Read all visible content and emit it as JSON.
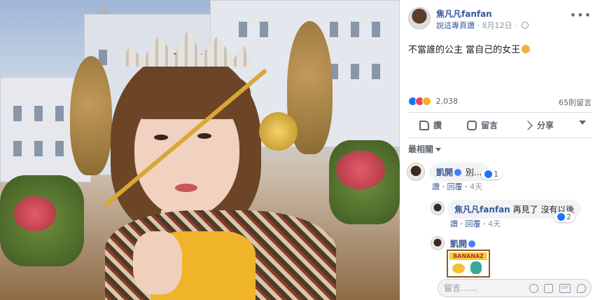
{
  "post": {
    "author": "焦凡凡fanfan",
    "meta_link": "說這專頁讚",
    "meta_sep": " · ",
    "date": "8月12日",
    "meta_dot": " · ",
    "caption": "不當誰的公主 當自己的女王",
    "more": "•••"
  },
  "stats": {
    "reactions_count": "2,038",
    "comments_count": "65則留言"
  },
  "actions": {
    "like": "讚",
    "comment": "留言",
    "share": "分享"
  },
  "sort_label": "最相關",
  "comments": [
    {
      "author": "凱開",
      "text": "別...",
      "likes": "1",
      "like_label": "讚",
      "reply_label": "回覆",
      "time": "4天"
    },
    {
      "author": "焦凡凡fanfan",
      "text": "再見了 沒有以後",
      "likes": "2",
      "like_label": "讚",
      "reply_label": "回覆",
      "time": "4天"
    },
    {
      "author": "凱開",
      "sticker_text": "BANANAZ"
    }
  ],
  "composer": {
    "placeholder": "留言……",
    "gif": "GIF"
  }
}
